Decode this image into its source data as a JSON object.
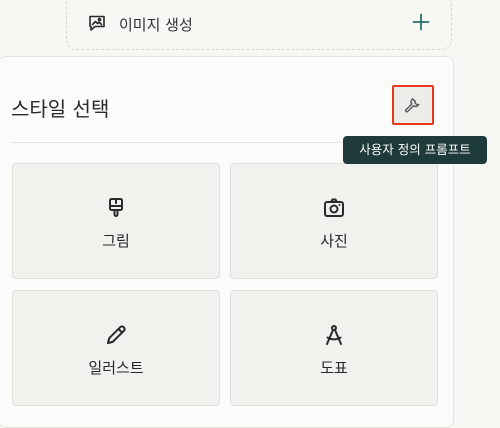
{
  "create_image": {
    "label": "이미지 생성",
    "icon": "image-chat-icon",
    "action_icon": "plus-icon"
  },
  "style_panel": {
    "title": "스타일 선택",
    "custom_button_icon": "wrench-icon",
    "tooltip": "사용자 정의 프롬프트",
    "accent_color": "#e8371f",
    "tooltip_color": "#1f3a3a",
    "styles": [
      {
        "label": "그림",
        "icon": "paintbrush-icon"
      },
      {
        "label": "사진",
        "icon": "camera-icon"
      },
      {
        "label": "일러스트",
        "icon": "pencil-icon"
      },
      {
        "label": "도표",
        "icon": "compass-icon"
      }
    ]
  }
}
